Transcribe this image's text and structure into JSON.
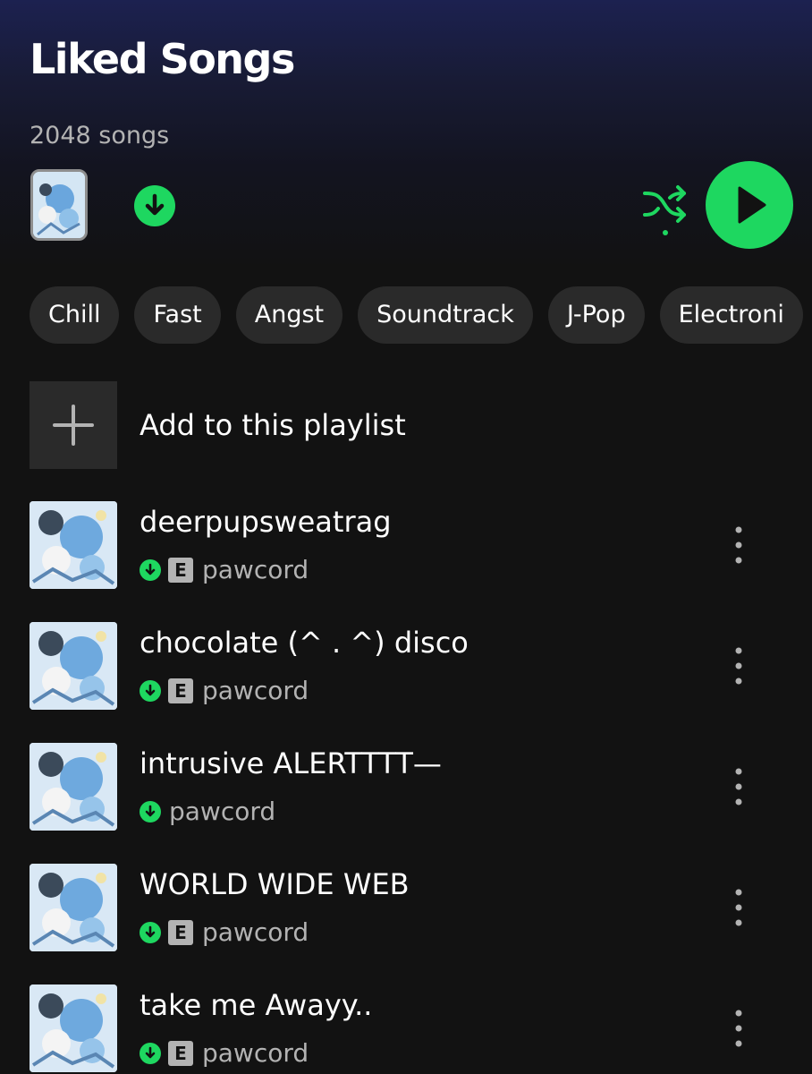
{
  "header": {
    "title": "Liked Songs",
    "song_count": "2048 songs"
  },
  "controls": {
    "download_icon": "download-circle-icon",
    "shuffle_icon": "shuffle-icon",
    "play_icon": "play-icon",
    "accent_color": "#1ed760"
  },
  "filters": [
    "Chill",
    "Fast",
    "Angst",
    "Soundtrack",
    "J-Pop",
    "Electroni"
  ],
  "add_to_playlist": {
    "label": "Add to this playlist",
    "icon": "plus-icon"
  },
  "tracks": [
    {
      "title": "deerpupsweatrag",
      "artist": "pawcord",
      "explicit": true,
      "downloaded": true
    },
    {
      "title": "chocolate (^ . ^) disco",
      "artist": "pawcord",
      "explicit": true,
      "downloaded": true
    },
    {
      "title": "intrusive ALERTTTT—",
      "artist": "pawcord",
      "explicit": false,
      "downloaded": true
    },
    {
      "title": "WORLD WIDE WEB",
      "artist": "pawcord",
      "explicit": true,
      "downloaded": true
    },
    {
      "title": "take me Awayy..",
      "artist": "pawcord",
      "explicit": true,
      "downloaded": true
    }
  ],
  "explicit_badge": "E"
}
